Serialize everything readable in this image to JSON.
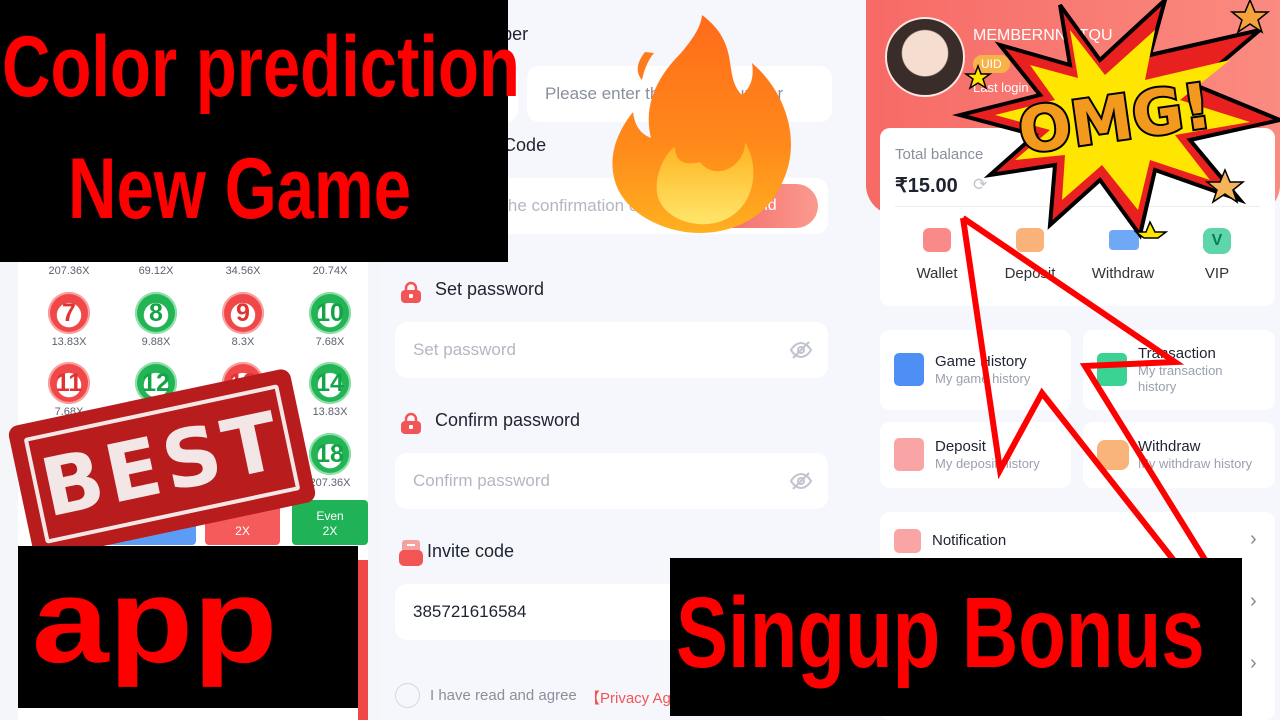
{
  "overlay": {
    "title_line1": "Color prediction",
    "title_line2": "New Game",
    "stamp": "BEST",
    "app_label": "app",
    "bonus_label": "Singup Bonus",
    "omg": "OMG!"
  },
  "game": {
    "top_multipliers": [
      "207.36X",
      "69.12X",
      "34.56X",
      "20.74X"
    ],
    "rows": [
      [
        {
          "n": "7",
          "c": "red",
          "m": "13.83X"
        },
        {
          "n": "8",
          "c": "green",
          "m": "9.88X"
        },
        {
          "n": "9",
          "c": "red",
          "m": "8.3X"
        },
        {
          "n": "10",
          "c": "green",
          "m": "7.68X"
        }
      ],
      [
        {
          "n": "11",
          "c": "red",
          "m": "7.68X"
        },
        {
          "n": "12",
          "c": "green",
          "m": ""
        },
        {
          "n": "13",
          "c": "red",
          "m": ""
        },
        {
          "n": "14",
          "c": "green",
          "m": "13.83X"
        }
      ]
    ],
    "ball_18": {
      "n": "18",
      "m": "207.36X"
    },
    "odd_button": "2X",
    "even_button": {
      "label": "Even",
      "mult": "2X"
    }
  },
  "signup": {
    "phone_label": "Phone number",
    "phone_placeholder": "Please enter the phone number",
    "code_label": "Verification Code",
    "code_placeholder": "Please enter the confirmation code",
    "send_button": "Send",
    "set_password_label": "Set password",
    "set_password_placeholder": "Set password",
    "confirm_password_label": "Confirm password",
    "confirm_password_placeholder": "Confirm password",
    "invite_label": "Invite code",
    "invite_value": "385721616584",
    "agree_text": "I have read and agree",
    "privacy_link": "【Privacy Agreement】"
  },
  "profile": {
    "name": "MEMBERNNGTQU",
    "uid_label": "UID",
    "last_login": "Last login",
    "balance_label": "Total balance",
    "balance": "₹15.00",
    "actions": [
      "Wallet",
      "Deposit",
      "Withdraw",
      "VIP"
    ],
    "cards": [
      {
        "title": "Game History",
        "sub": "My game history"
      },
      {
        "title": "Transaction",
        "sub": "My transaction history"
      },
      {
        "title": "Deposit",
        "sub": "My deposit history"
      },
      {
        "title": "Withdraw",
        "sub": "My withdraw history"
      }
    ],
    "notification": "Notification"
  },
  "colors": {
    "accent": "#f85a5a",
    "overlay_red": "#ff0000",
    "green": "#22b455"
  }
}
